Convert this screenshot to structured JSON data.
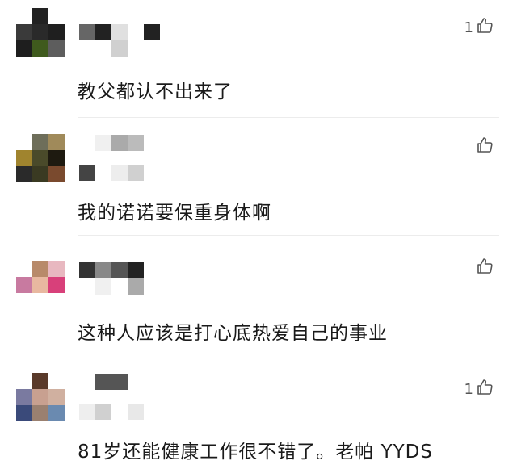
{
  "comments": [
    {
      "text": "教父都认不出来了",
      "likes": "1",
      "avatar_colors": [
        "#ffffff",
        "#222222",
        "#ffffff",
        "#3a3a3a",
        "#2a2a2a",
        "#1f1f1f",
        "#1e1e1e",
        "#3f5a1d",
        "#5d5d5d"
      ],
      "name_mosaic": [
        "#666666",
        "#222222",
        "#e0e0e0",
        "#ffffff",
        "#222222"
      ],
      "name_mosaic2": [
        "#ffffff",
        "#ffffff",
        "#d0d0d0",
        "#ffffff",
        "#ffffff"
      ]
    },
    {
      "text": "我的诺诺要保重身体啊",
      "likes": "",
      "avatar_colors": [
        "#ffffff",
        "#6e6e5a",
        "#a08a5a",
        "#a0842e",
        "#4a4a2a",
        "#1e1a10",
        "#2a2a2a",
        "#3a3a22",
        "#7a4a2e"
      ],
      "name_mosaic": [
        "#ffffff",
        "#f0f0f0",
        "#aaaaaa",
        "#bbbbbb",
        "#ffffff"
      ],
      "name_mosaic2": [
        "#444444",
        "#ffffff",
        "#ededed",
        "#d0d0d0",
        "#ffffff"
      ]
    },
    {
      "text": "这种人应该是打心底热爱自己的事业",
      "likes": "",
      "avatar_colors": [
        "#ffffff",
        "#b88a6a",
        "#e8b8c0",
        "#c87aa0",
        "#e8b8a0",
        "#d8407a",
        "#ffffff",
        "#ffffff",
        "#ffffff"
      ],
      "name_mosaic": [
        "#333333",
        "#888888",
        "#555555",
        "#222222",
        "#ffffff"
      ],
      "name_mosaic2": [
        "#ffffff",
        "#f0f0f0",
        "#ffffff",
        "#aaaaaa",
        "#ffffff"
      ]
    },
    {
      "text": "81岁还能健康工作很不错了。老帕 YYDS",
      "likes": "1",
      "avatar_colors": [
        "#ffffff",
        "#5a3a2a",
        "#ffffff",
        "#7a7aa0",
        "#c8a090",
        "#d0b0a0",
        "#3a4a7a",
        "#9a8070",
        "#6a8ab0"
      ],
      "name_mosaic": [
        "#ffffff",
        "#555555",
        "#555555",
        "#ffffff",
        "#ffffff"
      ],
      "name_mosaic2": [
        "#eeeeee",
        "#d0d0d0",
        "#ffffff",
        "#e8e8e8",
        "#ffffff"
      ]
    }
  ]
}
